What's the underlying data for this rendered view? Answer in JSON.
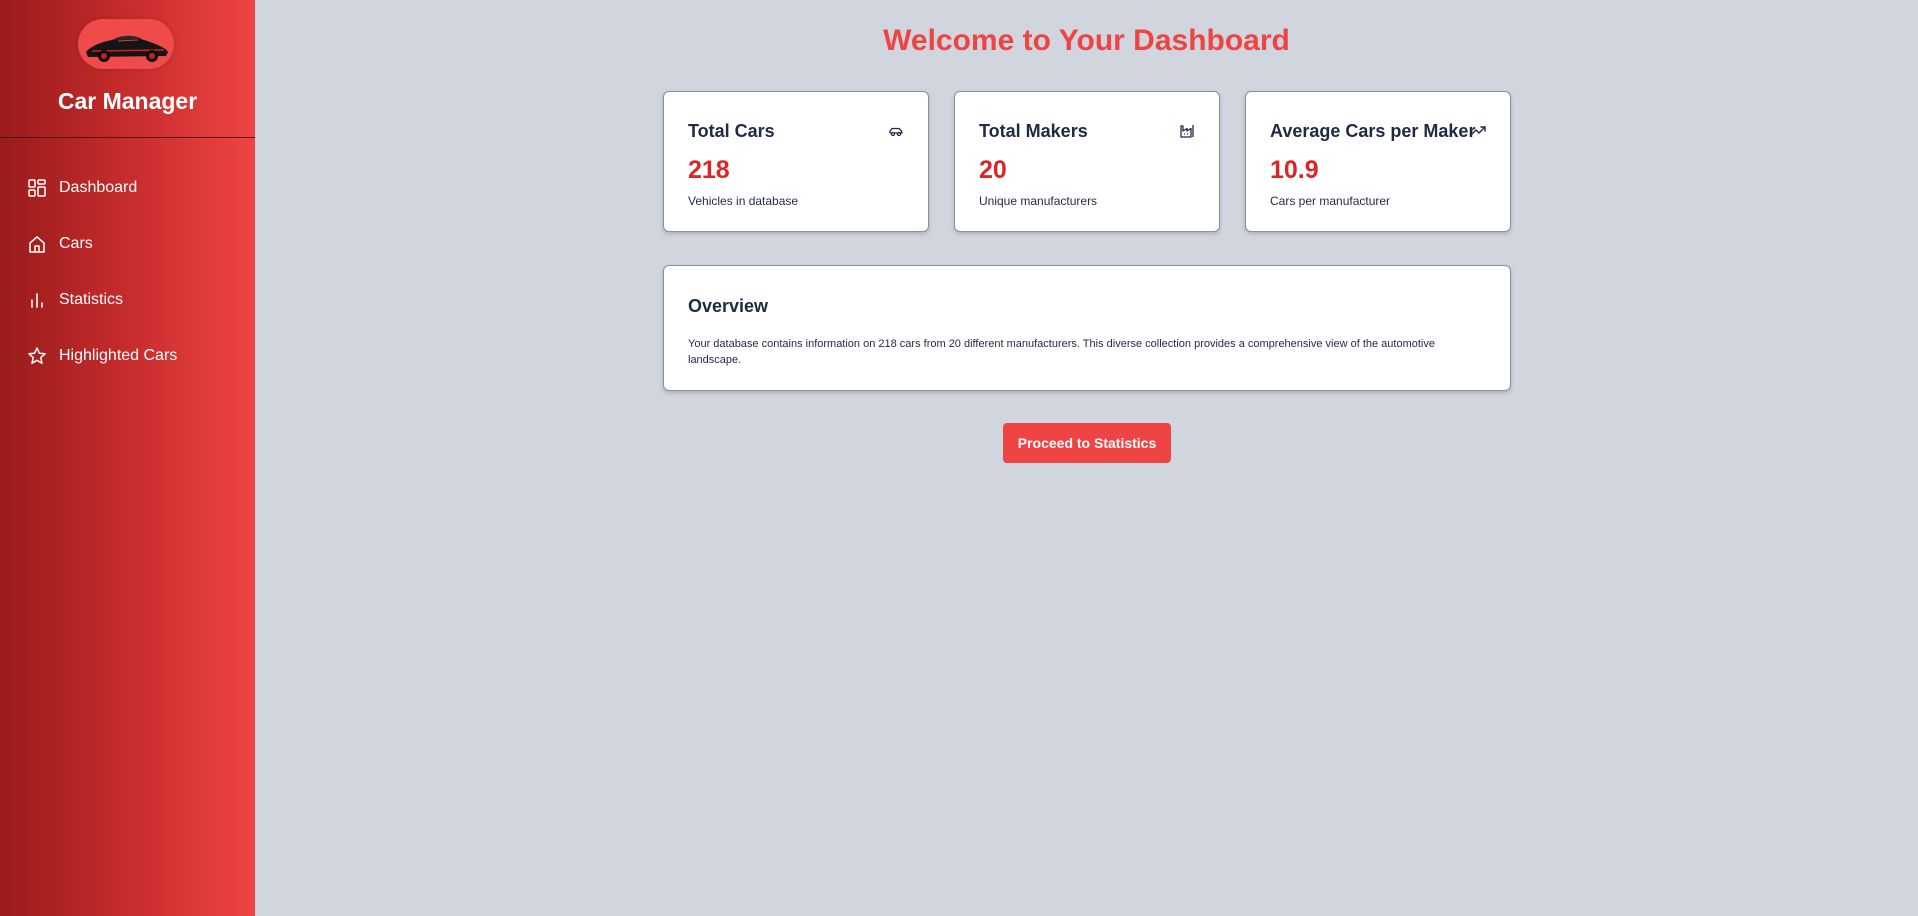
{
  "sidebar": {
    "app_title": "Car Manager",
    "logo_icon": "sports-car-logo",
    "items": [
      {
        "label": "Dashboard",
        "icon": "dashboard-grid-icon"
      },
      {
        "label": "Cars",
        "icon": "home-icon"
      },
      {
        "label": "Statistics",
        "icon": "bar-chart-icon"
      },
      {
        "label": "Highlighted Cars",
        "icon": "star-icon"
      }
    ]
  },
  "main": {
    "title": "Welcome to Your Dashboard",
    "stats": [
      {
        "title": "Total Cars",
        "value": "218",
        "description": "Vehicles in database",
        "icon": "car-icon"
      },
      {
        "title": "Total Makers",
        "value": "20",
        "description": "Unique manufacturers",
        "icon": "factory-icon"
      },
      {
        "title": "Average Cars per Maker",
        "value": "10.9",
        "description": "Cars per manufacturer",
        "icon": "trending-up-icon"
      }
    ],
    "overview": {
      "title": "Overview",
      "text": "Your database contains information on 218 cars from 20 different manufacturers. This diverse collection provides a comprehensive view of the automotive landscape."
    },
    "cta_label": "Proceed to Statistics"
  },
  "colors": {
    "accent": "#ef4444",
    "value_red": "#dc2626",
    "sidebar_dark": "#991b1b",
    "background": "#d1d5de",
    "text_dark": "#1f2a44"
  }
}
